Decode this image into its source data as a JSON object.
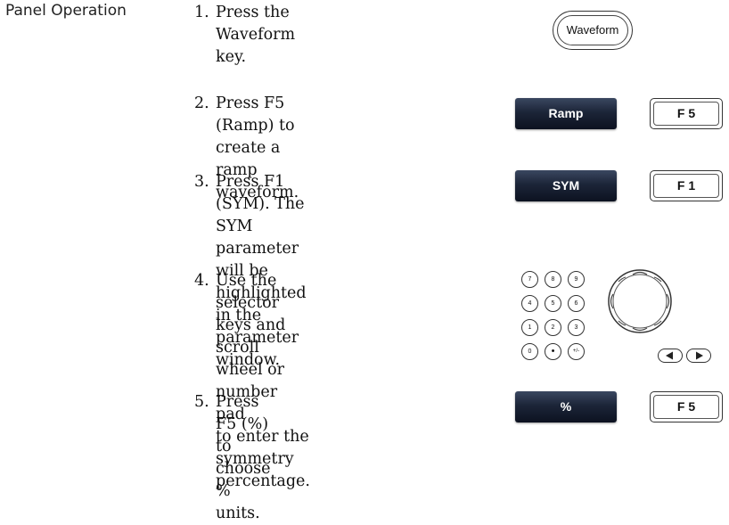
{
  "section_label": "Panel Operation",
  "steps": [
    {
      "num": "1.",
      "lines": [
        "Press the Waveform key."
      ]
    },
    {
      "num": "2.",
      "lines": [
        "Press F5 (Ramp) to create a",
        "ramp waveform."
      ]
    },
    {
      "num": "3.",
      "lines": [
        "Press F1 (SYM). The SYM",
        "parameter will be highlighted",
        "in the parameter window."
      ]
    },
    {
      "num": "4.",
      "lines": [
        "Use the selector keys and",
        "scroll wheel or number pad",
        "to enter the symmetry",
        "percentage."
      ]
    },
    {
      "num": "5.",
      "lines": [
        "Press F5 (%) to choose %",
        "units."
      ]
    }
  ],
  "keys": {
    "waveform": "Waveform",
    "ramp_soft": "Ramp",
    "ramp_fkey": "F 5",
    "sym_soft": "SYM",
    "sym_fkey": "F 1",
    "pct_soft": "%",
    "pct_fkey": "F 5"
  },
  "numpad": [
    [
      "7",
      "8",
      "9"
    ],
    [
      "4",
      "5",
      "6"
    ],
    [
      "1",
      "2",
      "3"
    ],
    [
      "0",
      "•",
      "+/-"
    ]
  ],
  "icons": {
    "wheel": "scroll-wheel-icon",
    "left": "left-arrow-key-icon",
    "right": "right-arrow-key-icon"
  }
}
